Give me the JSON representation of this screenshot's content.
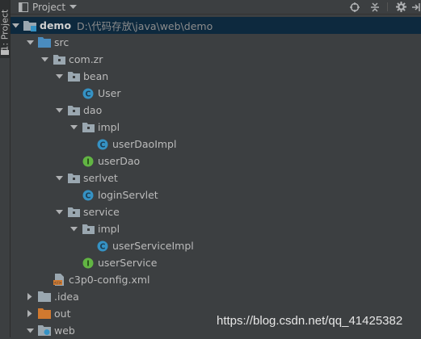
{
  "stripe": {
    "label": "1: Project"
  },
  "header": {
    "title": "Project",
    "dropdown_icon": "caret-down-icon",
    "actions": [
      "target-icon",
      "collapse-icon",
      "gear-icon",
      "hide-icon"
    ]
  },
  "tree": [
    {
      "id": "demo",
      "label": "demo",
      "path": "D:\\代码存放\\java\\web\\demo",
      "icon": "module-folder",
      "state": "expanded"
    },
    {
      "id": "src",
      "label": "src",
      "icon": "source-folder",
      "state": "expanded"
    },
    {
      "id": "com-zr",
      "label": "com.zr",
      "icon": "package",
      "state": "expanded"
    },
    {
      "id": "bean",
      "label": "bean",
      "icon": "package",
      "state": "expanded"
    },
    {
      "id": "user",
      "label": "User",
      "icon": "class"
    },
    {
      "id": "dao",
      "label": "dao",
      "icon": "package",
      "state": "expanded"
    },
    {
      "id": "dao-impl",
      "label": "impl",
      "icon": "package",
      "state": "expanded"
    },
    {
      "id": "userdaoimpl",
      "label": "userDaoImpl",
      "icon": "class"
    },
    {
      "id": "userdao",
      "label": "userDao",
      "icon": "interface"
    },
    {
      "id": "serlvet",
      "label": "serlvet",
      "icon": "package",
      "state": "expanded"
    },
    {
      "id": "loginservlet",
      "label": "loginServlet",
      "icon": "class"
    },
    {
      "id": "service",
      "label": "service",
      "icon": "package",
      "state": "expanded"
    },
    {
      "id": "service-impl",
      "label": "impl",
      "icon": "package",
      "state": "expanded"
    },
    {
      "id": "userserviceimpl",
      "label": "userServiceImpl",
      "icon": "class"
    },
    {
      "id": "userservice",
      "label": "userService",
      "icon": "interface"
    },
    {
      "id": "c3p0",
      "label": "c3p0-config.xml",
      "icon": "xml-file"
    },
    {
      "id": "idea",
      "label": ".idea",
      "icon": "folder",
      "state": "collapsed"
    },
    {
      "id": "out",
      "label": "out",
      "icon": "excluded-folder",
      "state": "collapsed"
    },
    {
      "id": "web",
      "label": "web",
      "icon": "web-folder",
      "state": "expanded"
    }
  ],
  "watermark": "https://blog.csdn.net/qq_41425382",
  "colors": {
    "background": "#3c3f41",
    "selection": "#0d293e",
    "text": "#bbbbbb",
    "class_icon": "#3592c4",
    "interface_icon": "#62b543",
    "source_folder": "#4a8cbf",
    "excluded_folder": "#d1792f"
  }
}
